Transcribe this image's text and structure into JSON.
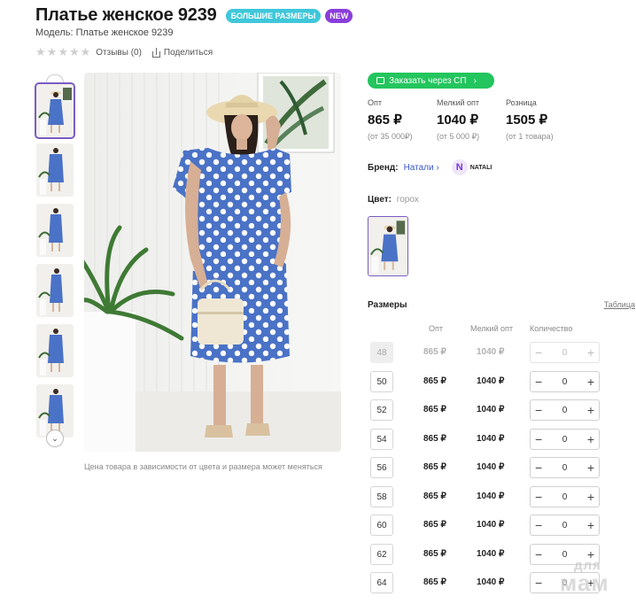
{
  "product": {
    "title": "Платье женское 9239",
    "badge_big_sizes": "БОЛЬШИЕ РАЗМЕРЫ",
    "badge_new": "NEW",
    "model": "Модель: Платье женское 9239"
  },
  "rating": {
    "stars_filled": 0,
    "stars_total": 5,
    "reviews_label": "Отзывы (0)",
    "share_label": "Поделиться"
  },
  "gallery": {
    "thumb_count": 6,
    "selected_thumb": 1,
    "note": "Цена товара в зависимости от цвета и размера может меняться"
  },
  "order": {
    "button_label": "Заказать через СП"
  },
  "prices": [
    {
      "label": "Опт",
      "value": "865 ₽",
      "sub": "(от 35 000₽)"
    },
    {
      "label": "Мелкий опт",
      "value": "1040 ₽",
      "sub": "(от 5 000 ₽)"
    },
    {
      "label": "Розница",
      "value": "1505 ₽",
      "sub": "(от 1 товара)"
    }
  ],
  "brand": {
    "label": "Бренд:",
    "name": "Натали",
    "logo_letter": "N",
    "logo_text": "NATALI"
  },
  "color": {
    "label": "Цвет:",
    "value": "горох"
  },
  "sizes": {
    "title": "Размеры",
    "table_link": "Таблица",
    "col_opt": "Опт",
    "col_small": "Мелкий опт",
    "col_qty": "Количество",
    "rows": [
      {
        "size": "48",
        "opt": "865 ₽",
        "small": "1040 ₽",
        "qty": "0",
        "disabled": true
      },
      {
        "size": "50",
        "opt": "865 ₽",
        "small": "1040 ₽",
        "qty": "0",
        "disabled": false
      },
      {
        "size": "52",
        "opt": "865 ₽",
        "small": "1040 ₽",
        "qty": "0",
        "disabled": false
      },
      {
        "size": "54",
        "opt": "865 ₽",
        "small": "1040 ₽",
        "qty": "0",
        "disabled": false
      },
      {
        "size": "56",
        "opt": "865 ₽",
        "small": "1040 ₽",
        "qty": "0",
        "disabled": false
      },
      {
        "size": "58",
        "opt": "865 ₽",
        "small": "1040 ₽",
        "qty": "0",
        "disabled": false
      },
      {
        "size": "60",
        "opt": "865 ₽",
        "small": "1040 ₽",
        "qty": "0",
        "disabled": false
      },
      {
        "size": "62",
        "opt": "865 ₽",
        "small": "1040 ₽",
        "qty": "0",
        "disabled": false
      },
      {
        "size": "64",
        "opt": "865 ₽",
        "small": "1040 ₽",
        "qty": "0",
        "disabled": false
      }
    ]
  },
  "watermark": {
    "small": "для",
    "big": "мам"
  },
  "colors": {
    "accent_purple": "#7a5cc2",
    "badge_cyan": "#3fc7d9",
    "badge_new": "#8a3ddb",
    "order_green": "#23c55e",
    "link_blue": "#3b57c4",
    "dress_blue": "#4a72c6"
  },
  "icons": {
    "star": "star-icon",
    "share": "share-icon",
    "cart": "cart-icon",
    "chevron_right": "chevron-right-icon",
    "chevron_down": "chevron-down-icon",
    "minus": "minus-icon",
    "plus": "plus-icon"
  }
}
